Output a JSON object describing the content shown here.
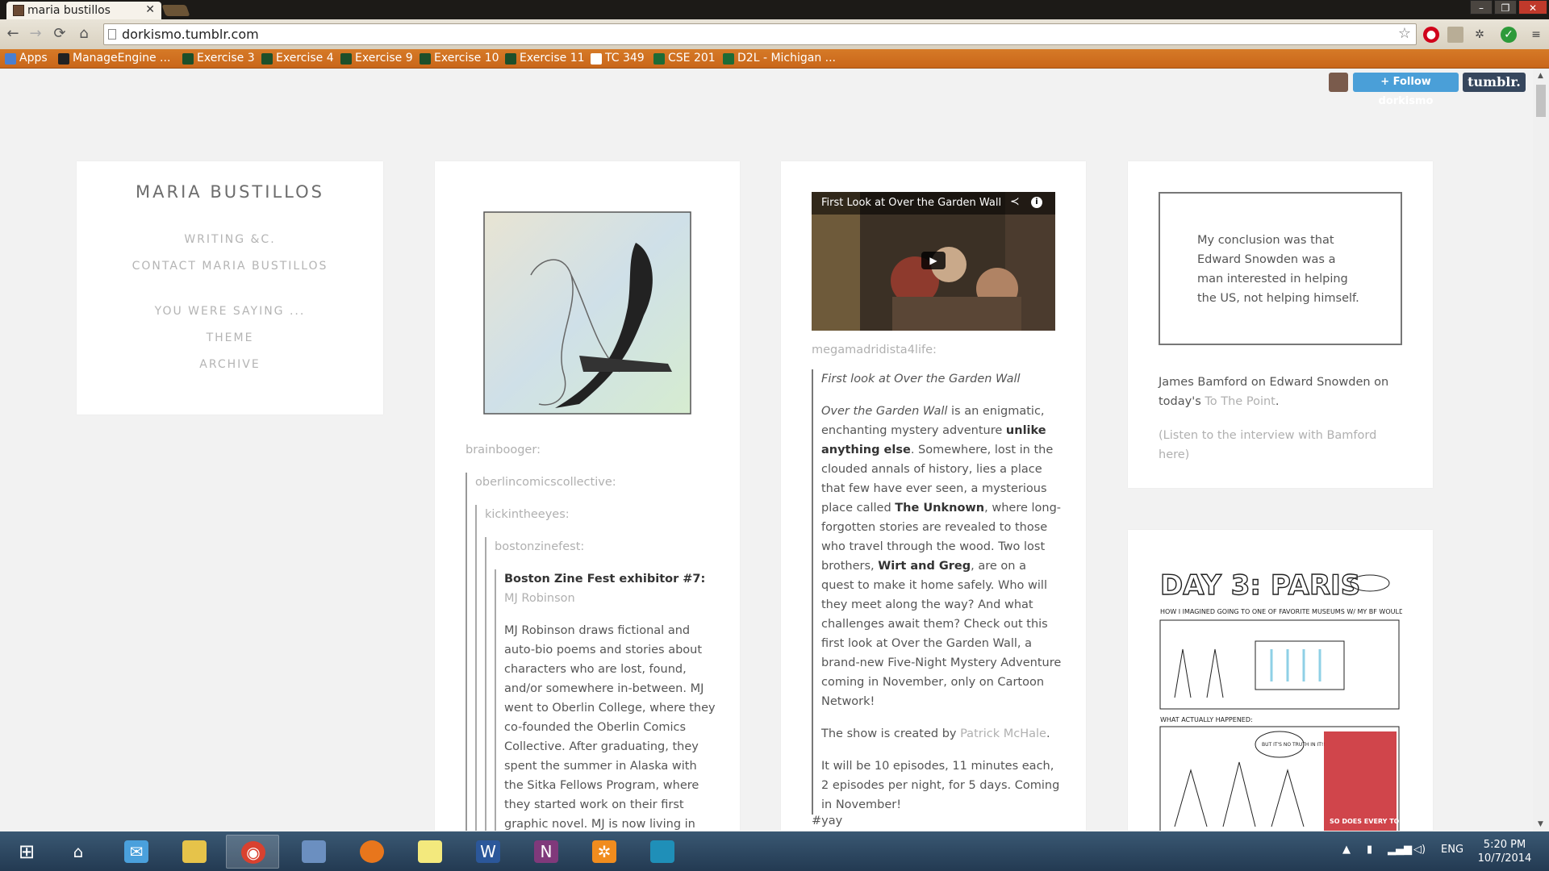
{
  "browser": {
    "tab_title": "maria bustillos",
    "tab_close": "✕",
    "window_controls": [
      "–",
      "❐",
      "✕"
    ],
    "url": "dorkismo.tumblr.com",
    "nav": {
      "back": "←",
      "forward": "→",
      "reload": "⟳",
      "home": "⌂"
    },
    "star": "☆",
    "extensions": [
      "stop-icon",
      "cast-icon",
      "settings-icon",
      "shield-icon",
      "menu-icon"
    ],
    "bookmarks": [
      {
        "label": "Apps",
        "icon": "apps-grid-icon"
      },
      {
        "label": "ManageEngine ...",
        "icon": "manageengine-icon"
      },
      {
        "label": "Exercise 3",
        "icon": "spartan-icon"
      },
      {
        "label": "Exercise 4",
        "icon": "spartan-icon"
      },
      {
        "label": "Exercise 9",
        "icon": "spartan-icon"
      },
      {
        "label": "Exercise 10",
        "icon": "spartan-icon"
      },
      {
        "label": "Exercise 11",
        "icon": "spartan-icon"
      },
      {
        "label": "TC 349",
        "icon": "page-icon"
      },
      {
        "label": "CSE 201",
        "icon": "s-icon"
      },
      {
        "label": "D2L - Michigan ...",
        "icon": "s-icon"
      }
    ]
  },
  "tumblr_controls": {
    "follow": "+ Follow dorkismo",
    "logo": "tumblr."
  },
  "sidebar": {
    "title": "MARIA BUSTILLOS",
    "nav": [
      "WRITING &C.",
      "CONTACT MARIA BUSTILLOS",
      "YOU WERE SAYING ...",
      "THEME",
      "ARCHIVE"
    ]
  },
  "post1": {
    "reblog_chain": [
      "brainbooger",
      "oberlincomicscollective",
      "kickintheeyes",
      "bostonzinefest"
    ],
    "headline_bold": "Boston Zine Fest exhibitor #7:",
    "headline_link": "MJ Robinson",
    "body": "MJ Robinson draws fictional and auto-bio poems and stories about characters who are lost, found, and/or somewhere in-between. MJ went to Oberlin College, where they co-founded the Oberlin Comics Collective. After graduating, they spent the summer in Alaska with the Sitka Fellows Program, where they started work on their first graphic novel. MJ is now living in Providence"
  },
  "post2": {
    "video_title": "First Look at Over the Garden Wall",
    "reblogged_from": "megamadridista4life",
    "quote_title": "First look at Over the Garden Wall",
    "p1_italic": "Over the Garden Wall",
    "p1_a": " is an enigmatic, enchanting mystery adventure ",
    "p1_bold1": "unlike anything else",
    "p1_b": ". Somewhere, lost in the clouded annals of history, lies a place that few have ever seen, a mysterious place called ",
    "p1_bold2": "The Unknown",
    "p1_c": ", where long-forgotten stories are revealed to those who travel through the wood. Two lost brothers, ",
    "p1_bold3": "Wirt and Greg",
    "p1_d": ", are on a quest to make it home safely. Who will they meet along the way? And what challenges await them? Check out this first look at Over the Garden Wall, a brand-new Five-Night Mystery Adventure coming in November, only on Cartoon Network!",
    "p2_a": "The show is created by ",
    "p2_link": "Patrick McHale",
    "p2_b": ".",
    "p3": "It will be 10 episodes, 11 minutes each, 2 episodes per night, for 5 days. Coming in November!",
    "tag": "#yay"
  },
  "post3": {
    "quote": "My conclusion was that Edward Snowden was a man interested in helping the US, not helping himself.",
    "source_a": "James Bamford on Edward Snowden on today's ",
    "source_link": "To The Point",
    "source_b": ".",
    "listen": "(Listen to the interview with Bamford here)"
  },
  "post4": {
    "comic_title": "DAY 3: PARIS",
    "caption_top": "HOW I IMAGINED GOING TO ONE OF FAVORITE MUSEUMS W/ MY BF WOULD BE:",
    "caption_bottom": "WHAT ACTUALLY HAPPENED:",
    "bubble_a": "BUT IT'S NO TRUTH IN IT!!",
    "bubble_b": "SO DOES EVERY TOURIST"
  },
  "taskbar": {
    "apps": [
      "start",
      "home",
      "mail",
      "file-explorer",
      "chrome",
      "python",
      "firefox",
      "sticky-notes",
      "word",
      "onenote",
      "settings",
      "photos"
    ],
    "lang": "ENG",
    "time": "5:20 PM",
    "date": "10/7/2014"
  },
  "colors": {
    "bookmark_bar": "#cd6b1f",
    "follow_btn": "#4a9fd8",
    "tumblr_logo": "#36465d",
    "page_bg": "#f2f2f2",
    "link_muted": "#b0b0b0"
  }
}
